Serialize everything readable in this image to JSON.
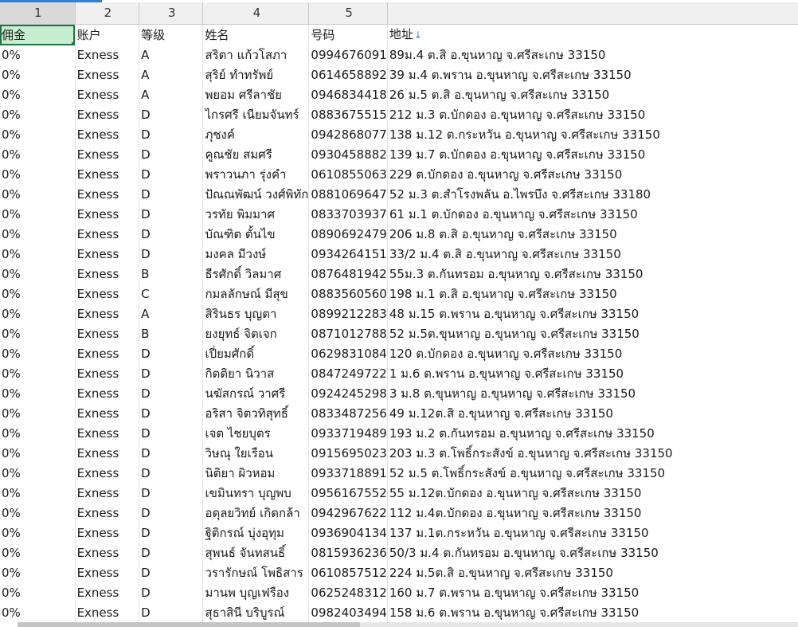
{
  "sheet": {
    "column_numbers": [
      "1",
      "2",
      "3",
      "4",
      "5"
    ],
    "headers": [
      "佣金",
      "账户",
      "等级",
      "姓名",
      "号码",
      "地址"
    ],
    "sort_indicator": "↓",
    "rows": [
      [
        "0%",
        "Exness",
        "A",
        "สริตา แก้วโสภา",
        "0994676091",
        "89ม.4 ต.สิ อ.ขุนหาญ จ.ศรีสะเกษ 33150"
      ],
      [
        "0%",
        "Exness",
        "A",
        "สุริย์ ทำทรัพย์",
        "0614658892",
        "39 ม.4 ต.พราน อ.ขุนหาญ จ.ศรีสะเกษ 33150"
      ],
      [
        "0%",
        "Exness",
        "A",
        "พยอม ศรีลาชัย",
        "0946834418",
        "26 ม.5 ต.สิ อ.ขุนหาญ จ.ศรีสะเกษ 33150"
      ],
      [
        "0%",
        "Exness",
        "D",
        "ไกรศรี เนียมจันทร์",
        "0883675515",
        "212 ม.3 ต.บักดอง อ.ขุนหาญ จ.ศรีสะเกษ 33150"
      ],
      [
        "0%",
        "Exness",
        "D",
        "ภุชงค์",
        "0942868077",
        "138 ม.12 ต.กระหวัน อ.ขุนหาญ จ.ศรีสะเกษ 33150"
      ],
      [
        "0%",
        "Exness",
        "D",
        "คูณชัย สมศรี",
        "0930458882",
        "139 ม.7 ต.บักดอง อ.ขุนหาญ จ.ศรีสะเกษ 33150"
      ],
      [
        "0%",
        "Exness",
        "D",
        "พราวนภา รุ่งคำ",
        "0610855063",
        "229 ต.บักดอง อ.ขุนหาญ จ.ศรีสะเกษ 33150"
      ],
      [
        "0%",
        "Exness",
        "D",
        "ปัณณพัฒน์ วงศ์พิทัก",
        "0881069647",
        "52 ม.3 ต.สำโรงพลัน อ.ไพรบึง จ.ศรีสะเกษ 33180"
      ],
      [
        "0%",
        "Exness",
        "D",
        "วรทัย พิมมาศ",
        "0833703937",
        "61 ม.1 ต.บักดอง อ.ขุนหาญ จ.ศรีสะเกษ 33150"
      ],
      [
        "0%",
        "Exness",
        "D",
        "บัณฑิต ตั้นไข",
        "0890692479",
        "206 ม.8 ต.สิ อ.ขุนหาญ จ.ศรีสะเกษ 33150"
      ],
      [
        "0%",
        "Exness",
        "D",
        "มงคล มีวงษ์",
        "0934264151",
        "33/2 ม.4 ต.สิ อ.ขุนหาญ จ.ศรีสะเกษ 33150"
      ],
      [
        "0%",
        "Exness",
        "B",
        "ธีรศักดิ์ วิลมาศ",
        "0876481942",
        "55ม.3 ต.กันทรอม อ.ขุนหาญ จ.ศรีสะเกษ 33150"
      ],
      [
        "0%",
        "Exness",
        "C",
        "กมลลักษณ์ มีสุข",
        "0883560560",
        "198 ม.1 ต.สิ อ.ขุนหาญ จ.ศรีสะเกษ 33150"
      ],
      [
        "0%",
        "Exness",
        "A",
        "สิรินธร บุญตา",
        "0899212283",
        "48 ม.15 ต.พราน อ.ขุนหาญ จ.ศรีสะเกษ 33150"
      ],
      [
        "0%",
        "Exness",
        "B",
        "ยงยุทธ์ จิตเจก",
        "0871012788",
        "52 ม.5ต.ขุนหาญ อ.ขุนหาญ จ.ศรีสะเกษ 33150"
      ],
      [
        "0%",
        "Exness",
        "D",
        "เปี่ยมศักดิ์",
        "0629831084",
        "120 ต.บักดอง อ.ขุนหาญ จ.ศรีสะเกษ 33150"
      ],
      [
        "0%",
        "Exness",
        "D",
        "กิตติยา นิวาส",
        "0847249722",
        "1 ม.6 ต.พราน อ.ขุนหาญ จ.ศรีสะเกษ 33150"
      ],
      [
        "0%",
        "Exness",
        "D",
        "นฆัสกรณ์ วาศรี",
        "0924245298",
        "3 ม.8 ต.ขุนหาญ อ.ขุนหาญ จ.ศรีสะเกษ 33150"
      ],
      [
        "0%",
        "Exness",
        "D",
        "อริสา จิตวทิสุทธิ์",
        "0833487256",
        "49 ม.12ต.สิ อ.ขุนหาญ จ.ศรีสะเกษ 33150"
      ],
      [
        "0%",
        "Exness",
        "D",
        "เจต ไชยบุตร",
        "0933719489",
        "193 ม.2 ต.กันทรอม อ.ขุนหาญ จ.ศรีสะเกษ 33150"
      ],
      [
        "0%",
        "Exness",
        "D",
        "วิษณุ ใยเรือน",
        "0915695023",
        "203 ม.3 ต.โพธิ์กระสังข์ อ.ขุนหาญ จ.ศรีสะเกษ 33150"
      ],
      [
        "0%",
        "Exness",
        "D",
        "นิติยา ผิวหอม",
        "0933718891",
        "52 ม.5 ต.โพธิ์กระสังข์ อ.ขุนหาญ จ.ศรีสะเกษ 33150"
      ],
      [
        "0%",
        "Exness",
        "D",
        "เขมินทรา บุญพบ",
        "0956167552",
        "55 ม.12ต.บักดอง อ.ขุนหาญ จ.ศรีสะเกษ 33150"
      ],
      [
        "0%",
        "Exness",
        "D",
        "อดุลยวิทย์ เกิดกล้า",
        "0942967622",
        "112 ม.4ต.บักดอง อ.ขุนหาญ จ.ศรีสะเกษ 33150"
      ],
      [
        "0%",
        "Exness",
        "D",
        "ฐิติกรณ์ บุ่งอุทุม",
        "0936904134",
        "137 ม.1ต.กระหวัน อ.ขุนหาญ จ.ศรีสะเกษ 33150"
      ],
      [
        "0%",
        "Exness",
        "D",
        "สุพนธ์ จันทสนธิ์",
        "0815936236",
        "50/3 ม.4 ต.กันทรอม อ.ขุนหาญ จ.ศรีสะเกษ 33150"
      ],
      [
        "0%",
        "Exness",
        "D",
        "วรารักษณ์ โพธิสาร",
        "0610857512",
        "224 ม.5ต.สิ อ.ขุนหาญ จ.ศรีสะเกษ 33150"
      ],
      [
        "0%",
        "Exness",
        "D",
        "มานพ บุญเฟรือง",
        "0625248312",
        "160 ม.7 ต.พราน อ.ขุนหาญ จ.ศรีสะเกษ 33150"
      ],
      [
        "0%",
        "Exness",
        "D",
        "สุธาสินี บริบูรณ์",
        "0982403494",
        "158 ม.6 ต.พราน อ.ขุนหาญ จ.ศรีสะเกษ 33150"
      ]
    ]
  },
  "colors": {
    "selected_cell_fill": "#c7efcf",
    "selected_cell_border": "#217346",
    "sort_arrow": "#2f7fd6"
  }
}
